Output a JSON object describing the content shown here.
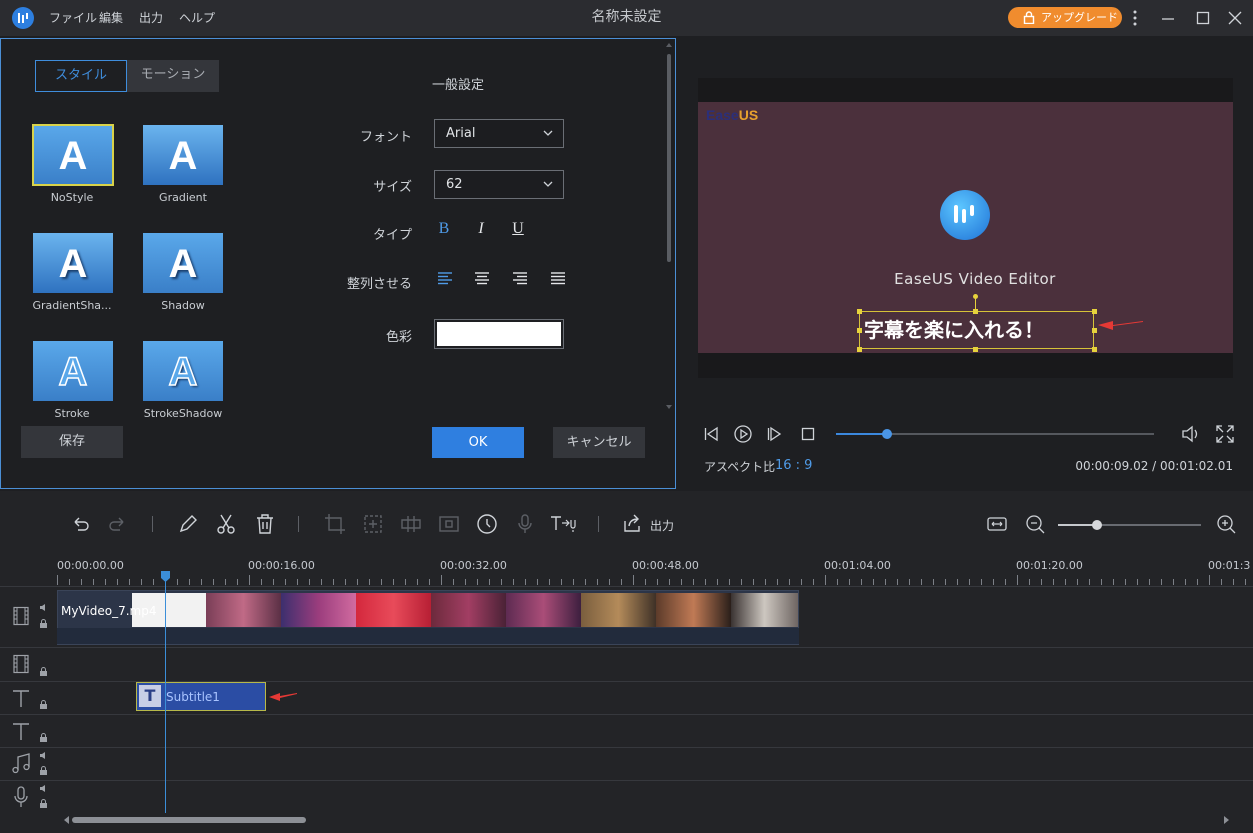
{
  "titlebar": {
    "menu": [
      "ファイル",
      "編集",
      "出力",
      "ヘルプ"
    ],
    "title": "名称未設定",
    "upgrade_label": "アップグレード"
  },
  "style_panel": {
    "tabs": [
      "スタイル",
      "モーション"
    ],
    "styles": [
      {
        "glyph": "A",
        "label": "NoStyle",
        "selected": true
      },
      {
        "glyph": "A",
        "label": "Gradient"
      },
      {
        "glyph": "A",
        "label": "GradientSha..."
      },
      {
        "glyph": "A",
        "label": "Shadow"
      },
      {
        "glyph": "A",
        "label": "Stroke"
      },
      {
        "glyph": "A",
        "label": "StrokeShadow"
      }
    ],
    "save_label": "保存",
    "general_title": "一般設定",
    "font_label": "フォント",
    "font_value": "Arial",
    "size_label": "サイズ",
    "size_value": "62",
    "type_label": "タイプ",
    "type_buttons": {
      "bold": "B",
      "italic": "I",
      "underline": "U"
    },
    "align_label": "整列させる",
    "color_label": "色彩",
    "color_value": "#ffffff",
    "ok_label": "OK",
    "cancel_label": "キャンセル"
  },
  "preview": {
    "brand_left": "Ease",
    "brand_right": "US",
    "editor_name": "EaseUS Video Editor",
    "subtitle_text": "字幕を楽に入れる！",
    "progress_fraction": 0.16,
    "aspect_label": "アスペクト比",
    "aspect_value": "16 : 9",
    "timecode": "00:00:09.02 / 00:01:02.01"
  },
  "toolbar": {
    "export_label": "出力",
    "zoom_fraction": 0.27
  },
  "timeline": {
    "ruler": [
      "00:00:00.00",
      "00:00:16.00",
      "00:00:32.00",
      "00:00:48.00",
      "00:01:04.00",
      "00:01:20.00",
      "00:01:3"
    ],
    "video_clip": "MyVideo_7.mp4",
    "subtitle_clip": "Subtitle1"
  },
  "colors": {
    "accent": "#3f8ddc",
    "upgrade": "#f08c2e",
    "ok_button": "#2f7fe0",
    "video_bg": "#4b303c",
    "arrow": "#e53935"
  }
}
